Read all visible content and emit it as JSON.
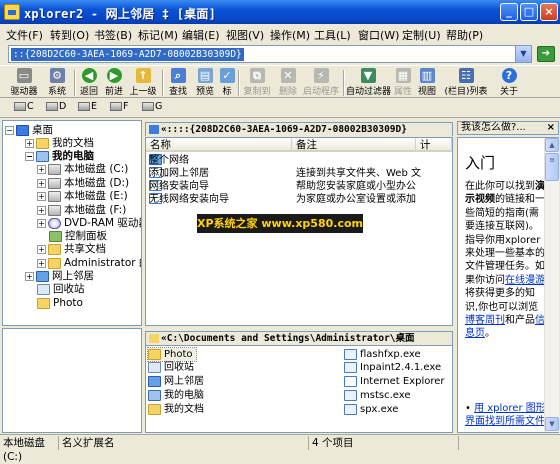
{
  "window": {
    "title": "xplorer2 - 网上邻居 ‡ [桌面]",
    "buttons": [
      "_",
      "□",
      "×"
    ]
  },
  "menu": [
    "文件(F)",
    "转到(O)",
    "书签(B)",
    "标记(M)",
    "编辑(E)",
    "视图(V)",
    "操作(M)",
    "工具(L)",
    "窗口(W)",
    "定制(U)",
    "帮助(P)"
  ],
  "address": {
    "value": "::{208D2C60-3AEA-1069-A2D7-08002B30309D}",
    "go_icon": "go-arrow-icon"
  },
  "toolbar": [
    {
      "label": "驱动器",
      "icon": "drive-icon",
      "enabled": true
    },
    {
      "label": "系统",
      "icon": "system-icon",
      "enabled": true
    },
    {
      "label": "返回",
      "icon": "back-icon",
      "enabled": true
    },
    {
      "label": "前进",
      "icon": "forward-icon",
      "enabled": true
    },
    {
      "label": "上一级",
      "icon": "up-icon",
      "enabled": true
    },
    {
      "label": "查找",
      "icon": "find-icon",
      "enabled": true
    },
    {
      "label": "预览",
      "icon": "preview-icon",
      "enabled": true
    },
    {
      "label": "标",
      "icon": "mark-icon",
      "enabled": true
    },
    {
      "label": "复制到",
      "icon": "copy-to-icon",
      "enabled": false
    },
    {
      "label": "删除",
      "icon": "delete-icon",
      "enabled": false
    },
    {
      "label": "启动程序",
      "icon": "launch-icon",
      "enabled": false
    },
    {
      "label": "自动过滤器",
      "icon": "filter-icon",
      "enabled": true
    },
    {
      "label": "属性",
      "icon": "properties-icon",
      "enabled": false
    },
    {
      "label": "视图",
      "icon": "view-icon",
      "enabled": true
    },
    {
      "label": "(栏目)列表",
      "icon": "columns-icon",
      "enabled": true
    },
    {
      "label": "关于",
      "icon": "about-icon",
      "enabled": true
    }
  ],
  "drives": [
    "C",
    "D",
    "E",
    "F",
    "G"
  ],
  "tree": [
    {
      "label": "桌面",
      "icon": "desktop",
      "level": 0,
      "exp": "-"
    },
    {
      "label": "我的文档",
      "icon": "folder",
      "level": 1,
      "exp": "+"
    },
    {
      "label": "我的电脑",
      "icon": "pc",
      "level": 1,
      "exp": "-",
      "bold": true
    },
    {
      "label": "本地磁盘 (C:)",
      "icon": "drive",
      "level": 2,
      "exp": "+"
    },
    {
      "label": "本地磁盘 (D:)",
      "icon": "drive",
      "level": 2,
      "exp": "+"
    },
    {
      "label": "本地磁盘 (E:)",
      "icon": "drive",
      "level": 2,
      "exp": "+"
    },
    {
      "label": "本地磁盘 (F:)",
      "icon": "drive",
      "level": 2,
      "exp": "+"
    },
    {
      "label": "DVD-RAM 驱动器",
      "icon": "cd",
      "level": 2,
      "exp": "+"
    },
    {
      "label": "控制面板",
      "icon": "cp",
      "level": 2,
      "exp": ""
    },
    {
      "label": "共享文档",
      "icon": "folder",
      "level": 2,
      "exp": "+"
    },
    {
      "label": "Administrator 的",
      "icon": "folder",
      "level": 2,
      "exp": "+"
    },
    {
      "label": "网上邻居",
      "icon": "net",
      "level": 1,
      "exp": "+"
    },
    {
      "label": "回收站",
      "icon": "bin",
      "level": 1,
      "exp": ""
    },
    {
      "label": "Photo",
      "icon": "folder",
      "level": 1,
      "exp": ""
    }
  ],
  "list_tab": "::{208D2C60-3AEA-1069-A2D7-08002B30309D}",
  "list_columns": [
    "名称",
    "备注",
    "计"
  ],
  "list_rows": [
    {
      "name": "整个网络",
      "note": "",
      "icon": "net"
    },
    {
      "name": "添加网上邻居",
      "note": "连接到共享文件夹、Web 文",
      "icon": "web"
    },
    {
      "name": "网络安装向导",
      "note": "帮助您安装家庭或小型办公",
      "icon": "web"
    },
    {
      "name": "无线网络安装向导",
      "note": "为家庭或办公室设置或添加",
      "icon": "web"
    }
  ],
  "watermark": "XP系统之家 www.xp580.com",
  "bottom_tab": "C:\\Documents and Settings\\Administrator\\桌面",
  "bottom_items_left": [
    {
      "label": "Photo",
      "icon": "folder"
    },
    {
      "label": "回收站",
      "icon": "bin"
    },
    {
      "label": "网上邻居",
      "icon": "net"
    },
    {
      "label": "我的电脑",
      "icon": "pc"
    },
    {
      "label": "我的文档",
      "icon": "folder"
    }
  ],
  "bottom_items_right": [
    {
      "label": "flashfxp.exe",
      "icon": "exe"
    },
    {
      "label": "Inpaint2.4.1.exe",
      "icon": "exe"
    },
    {
      "label": "Internet Explorer",
      "icon": "web"
    },
    {
      "label": "mstsc.exe",
      "icon": "exe"
    },
    {
      "label": "spx.exe",
      "icon": "exe"
    }
  ],
  "help": {
    "tab": "我该怎么做?...",
    "close": "×",
    "heading": "入门",
    "p1": "在此你可以找到",
    "bold1": "演示视频",
    "p2": "的链接和一些简短的指南(需要连接互联网)。指导你用xplorer 来处理一些基本的文件管理任务。如果你访问",
    "link1": "在线漫游",
    "p3": "将获得更多的知识,你也可以浏览",
    "link2": "博客周刊",
    "p4": "和产品",
    "link3": "信息页",
    "p5": "。",
    "bullet": "用 xplorer 图形界面找到所需文件"
  },
  "status": {
    "location": "本地磁盘 (C:)",
    "type": "名义扩展名",
    "count": "4 个项目"
  }
}
